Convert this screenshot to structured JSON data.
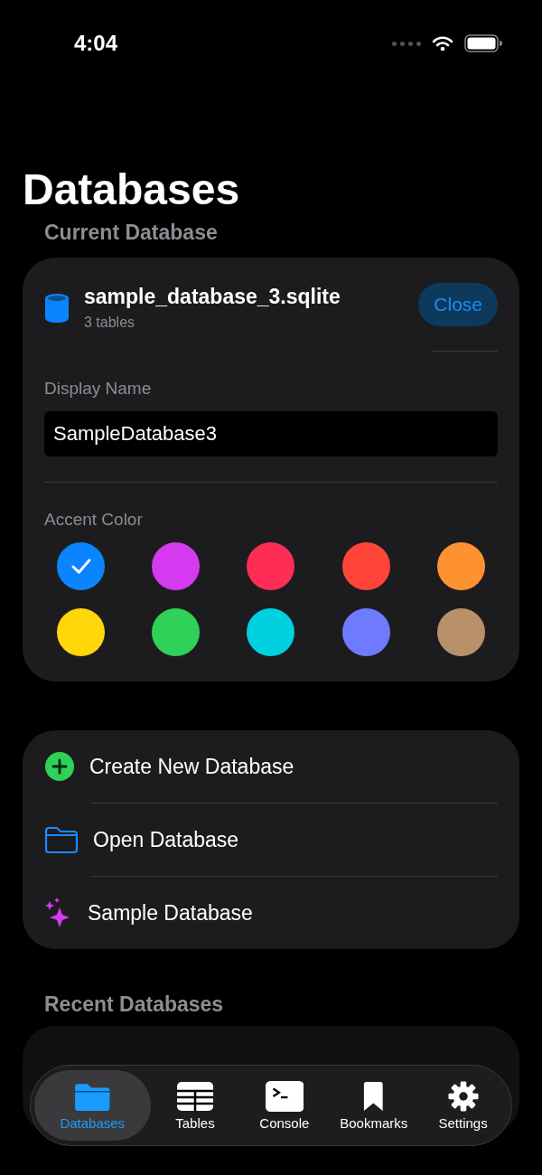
{
  "status_bar": {
    "time": "4:04"
  },
  "title": "Databases",
  "current_database": {
    "header": "Current Database",
    "name": "sample_database_3.sqlite",
    "subtitle": "3 tables",
    "close_button": "Close",
    "display_name_label": "Display Name",
    "display_name_value": "SampleDatabase3",
    "accent_label": "Accent Color",
    "accent_colors": [
      {
        "color": "#0a84ff",
        "selected": true
      },
      {
        "color": "#d53af0",
        "selected": false
      },
      {
        "color": "#ff2d55",
        "selected": false
      },
      {
        "color": "#ff453a",
        "selected": false
      },
      {
        "color": "#ff9230",
        "selected": false
      },
      {
        "color": "#ffd60a",
        "selected": false
      },
      {
        "color": "#30d158",
        "selected": false
      },
      {
        "color": "#00d0e0",
        "selected": false
      },
      {
        "color": "#6e7bff",
        "selected": false
      },
      {
        "color": "#b8906a",
        "selected": false
      }
    ]
  },
  "actions": [
    {
      "kind": "plus",
      "label": "Create New Database"
    },
    {
      "kind": "folder",
      "label": "Open Database"
    },
    {
      "kind": "sparkles",
      "label": "Sample Database"
    }
  ],
  "recent_header": "Recent Databases",
  "tabs": [
    {
      "kind": "folder",
      "label": "Databases",
      "selected": true
    },
    {
      "kind": "table",
      "label": "Tables",
      "selected": false
    },
    {
      "kind": "terminal",
      "label": "Console",
      "selected": false
    },
    {
      "kind": "bookmark",
      "label": "Bookmarks",
      "selected": false
    },
    {
      "kind": "gear",
      "label": "Settings",
      "selected": false
    }
  ]
}
